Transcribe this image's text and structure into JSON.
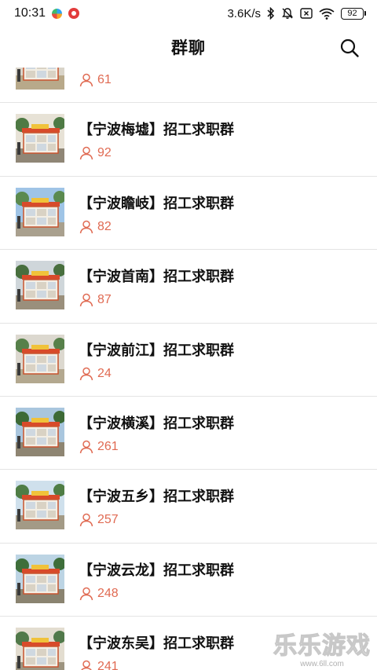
{
  "status_bar": {
    "time": "10:31",
    "network_speed": "3.6K/s",
    "battery": "92"
  },
  "header": {
    "title": "群聊"
  },
  "groups": [
    {
      "name": "",
      "members": "61"
    },
    {
      "name": "【宁波梅墟】招工求职群",
      "members": "92"
    },
    {
      "name": "【宁波瞻岐】招工求职群",
      "members": "82"
    },
    {
      "name": "【宁波首南】招工求职群",
      "members": "87"
    },
    {
      "name": "【宁波前江】招工求职群",
      "members": "24"
    },
    {
      "name": "【宁波横溪】招工求职群",
      "members": "261"
    },
    {
      "name": "【宁波五乡】招工求职群",
      "members": "257"
    },
    {
      "name": "【宁波云龙】招工求职群",
      "members": "248"
    },
    {
      "name": "【宁波东吴】招工求职群",
      "members": "241"
    }
  ],
  "watermark": {
    "text": "乐乐游戏",
    "url": "www.6ll.com"
  },
  "icons": {
    "search": "search-icon",
    "member": "person-icon",
    "thumbnail": "kiosk-photo"
  },
  "colors": {
    "member_count": "#e06a52",
    "kiosk_roof": "#d84a2a",
    "divider": "#e4e4e4"
  }
}
